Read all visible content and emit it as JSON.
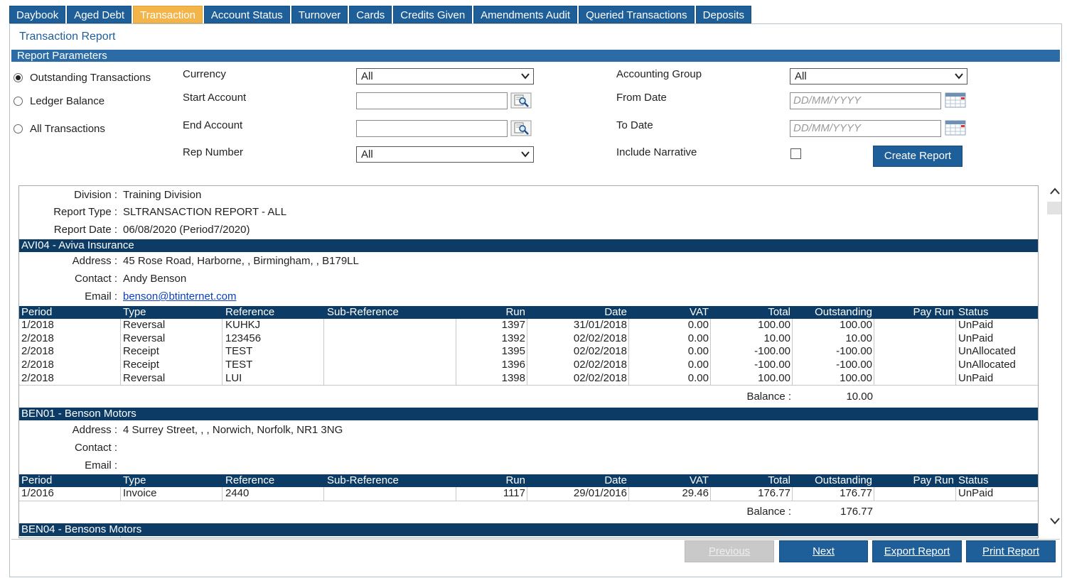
{
  "tabs": [
    {
      "label": "Daybook",
      "active": false
    },
    {
      "label": "Aged Debt",
      "active": false
    },
    {
      "label": "Transaction",
      "active": true
    },
    {
      "label": "Account Status",
      "active": false
    },
    {
      "label": "Turnover",
      "active": false
    },
    {
      "label": "Cards",
      "active": false
    },
    {
      "label": "Credits Given",
      "active": false
    },
    {
      "label": "Amendments Audit",
      "active": false
    },
    {
      "label": "Queried Transactions",
      "active": false
    },
    {
      "label": "Deposits",
      "active": false
    }
  ],
  "page_title": "Transaction Report",
  "section_title": "Report Parameters",
  "report_mode": {
    "options": [
      "Outstanding Transactions",
      "Ledger Balance",
      "All Transactions"
    ],
    "selected": "Outstanding Transactions"
  },
  "params": {
    "currency_label": "Currency",
    "currency_value": "All",
    "start_account_label": "Start Account",
    "start_account_value": "",
    "end_account_label": "End Account",
    "end_account_value": "",
    "rep_number_label": "Rep Number",
    "rep_number_value": "All",
    "accounting_group_label": "Accounting Group",
    "accounting_group_value": "All",
    "from_date_label": "From Date",
    "from_date_placeholder": "DD/MM/YYYY",
    "to_date_label": "To Date",
    "to_date_placeholder": "DD/MM/YYYY",
    "include_narrative_label": "Include Narrative",
    "include_narrative_checked": false,
    "create_report_label": "Create Report"
  },
  "report": {
    "header": {
      "division_label": "Division :",
      "division_value": "Training Division",
      "type_label": "Report Type :",
      "type_value": "SLTRANSACTION REPORT - ALL",
      "date_label": "Report Date :",
      "date_value": "06/08/2020 (Period7/2020)"
    },
    "columns": [
      "Period",
      "Type",
      "Reference",
      "Sub-Reference",
      "Run",
      "Date",
      "VAT",
      "Total",
      "Outstanding",
      "Pay Run",
      "Status"
    ],
    "address_label": "Address :",
    "contact_label": "Contact :",
    "email_label": "Email :",
    "balance_label": "Balance :",
    "accounts": [
      {
        "title": "AVI04 - Aviva Insurance",
        "address": "45 Rose Road,  Harborne,  ,  Birmingham,  ,  B179LL",
        "contact": "Andy Benson",
        "email": "benson@btinternet.com",
        "rows": [
          {
            "period": "1/2018",
            "type": "Reversal",
            "reference": "KUHKJ",
            "sub_reference": "",
            "run": "1397",
            "date": "31/01/2018",
            "vat": "0.00",
            "total": "100.00",
            "outstanding": "100.00",
            "pay_run": "",
            "status": "UnPaid"
          },
          {
            "period": "2/2018",
            "type": "Reversal",
            "reference": "123456",
            "sub_reference": "",
            "run": "1392",
            "date": "02/02/2018",
            "vat": "0.00",
            "total": "10.00",
            "outstanding": "10.00",
            "pay_run": "",
            "status": "UnPaid"
          },
          {
            "period": "2/2018",
            "type": "Receipt",
            "reference": "TEST",
            "sub_reference": "",
            "run": "1395",
            "date": "02/02/2018",
            "vat": "0.00",
            "total": "-100.00",
            "outstanding": "-100.00",
            "pay_run": "",
            "status": "UnAllocated"
          },
          {
            "period": "2/2018",
            "type": "Receipt",
            "reference": "TEST",
            "sub_reference": "",
            "run": "1396",
            "date": "02/02/2018",
            "vat": "0.00",
            "total": "-100.00",
            "outstanding": "-100.00",
            "pay_run": "",
            "status": "UnAllocated"
          },
          {
            "period": "2/2018",
            "type": "Reversal",
            "reference": "LUI",
            "sub_reference": "",
            "run": "1398",
            "date": "02/02/2018",
            "vat": "0.00",
            "total": "100.00",
            "outstanding": "100.00",
            "pay_run": "",
            "status": "UnPaid"
          }
        ],
        "balance": "10.00"
      },
      {
        "title": "BEN01 - Benson Motors",
        "address": "4 Surrey Street,  ,  ,  Norwich,  Norfolk,  NR1 3NG",
        "contact": "",
        "email": "",
        "rows": [
          {
            "period": "1/2016",
            "type": "Invoice",
            "reference": "2440",
            "sub_reference": "",
            "run": "1117",
            "date": "29/01/2016",
            "vat": "29.46",
            "total": "176.77",
            "outstanding": "176.77",
            "pay_run": "",
            "status": "UnPaid"
          }
        ],
        "balance": "176.77"
      },
      {
        "title": "BEN04 - Bensons Motors"
      }
    ]
  },
  "footer_buttons": {
    "previous": "Previous",
    "next": "Next",
    "export": "Export Report",
    "print": "Print Report"
  }
}
